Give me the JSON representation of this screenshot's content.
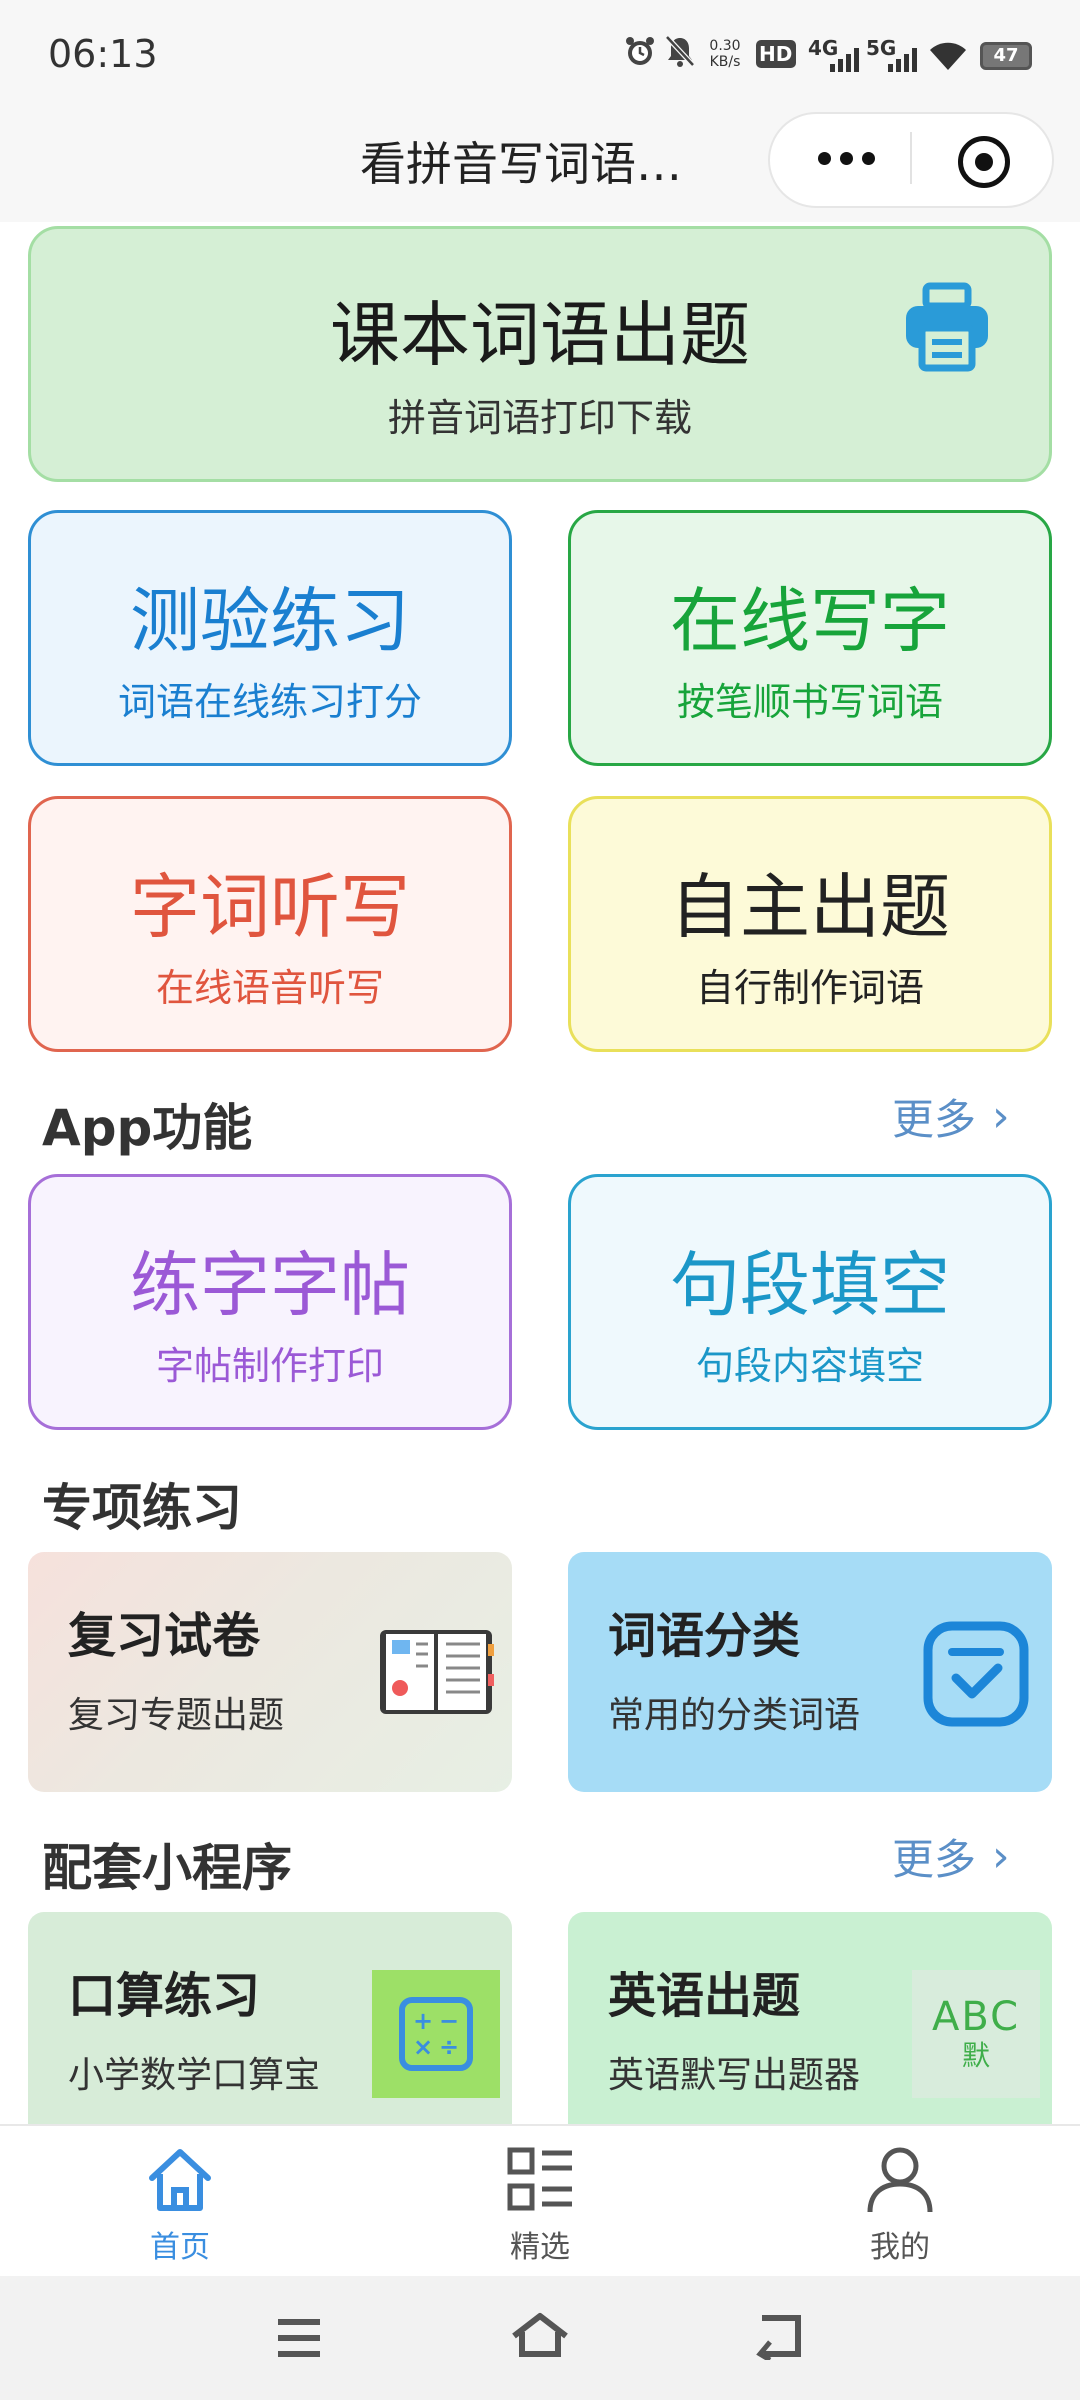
{
  "status_bar": {
    "time": "06:13",
    "net_speed_value": "0.30",
    "net_speed_unit": "KB/s",
    "hd_badge": "HD",
    "net_4g": "4G",
    "net_5g": "5G",
    "battery": "47"
  },
  "header": {
    "title": "看拼音写词语…"
  },
  "hero_card": {
    "title": "课本词语出题",
    "subtitle": "拼音词语打印下载",
    "icon": "printer-icon"
  },
  "tiles": [
    {
      "title": "测验练习",
      "subtitle": "词语在线练习打分",
      "color": "#1a7fd0",
      "bg": "#ebf5fd",
      "border": "#2f8fd4"
    },
    {
      "title": "在线写字",
      "subtitle": "按笔顺书写词语",
      "color": "#17a43a",
      "bg": "#e7f7e9",
      "border": "#28a745"
    },
    {
      "title": "字词听写",
      "subtitle": "在线语音听写",
      "color": "#e0553e",
      "bg": "#fff3f1",
      "border": "#e0654f"
    },
    {
      "title": "自主出题",
      "subtitle": "自行制作词语",
      "color": "#222222",
      "bg": "#fdfad8",
      "border": "#e9e05a"
    }
  ],
  "app_section": {
    "title": "App功能",
    "more": "更多",
    "tiles": [
      {
        "title": "练字字帖",
        "subtitle": "字帖制作打印",
        "color": "#9b59d6",
        "bg": "#f8f3fe",
        "border": "#a66fd8"
      },
      {
        "title": "句段填空",
        "subtitle": "句段内容填空",
        "color": "#1b97c8",
        "bg": "#eff9fd",
        "border": "#2aa3cf"
      }
    ]
  },
  "special_section": {
    "title": "专项练习",
    "items": [
      {
        "title": "复习试卷",
        "subtitle": "复习专题出题",
        "icon": "open-book-icon"
      },
      {
        "title": "词语分类",
        "subtitle": "常用的分类词语",
        "icon": "checkbox-icon"
      }
    ]
  },
  "mini_section": {
    "title": "配套小程序",
    "more": "更多",
    "items": [
      {
        "title": "口算练习",
        "subtitle": "小学数学口算宝",
        "icon": "calculator-icon",
        "icon_glyphs": [
          "+",
          "−",
          "×",
          "÷"
        ]
      },
      {
        "title": "英语出题",
        "subtitle": "英语默写出题器",
        "icon": "abc-icon",
        "icon_text": "ABC",
        "icon_subtext": "默"
      }
    ]
  },
  "bottom_nav": [
    {
      "label": "首页",
      "active": true
    },
    {
      "label": "精选",
      "active": false
    },
    {
      "label": "我的",
      "active": false
    }
  ],
  "colors": {
    "accent": "#3a8ee0",
    "hero_bg": "#d5efd5",
    "printer": "#2a9bd8"
  }
}
